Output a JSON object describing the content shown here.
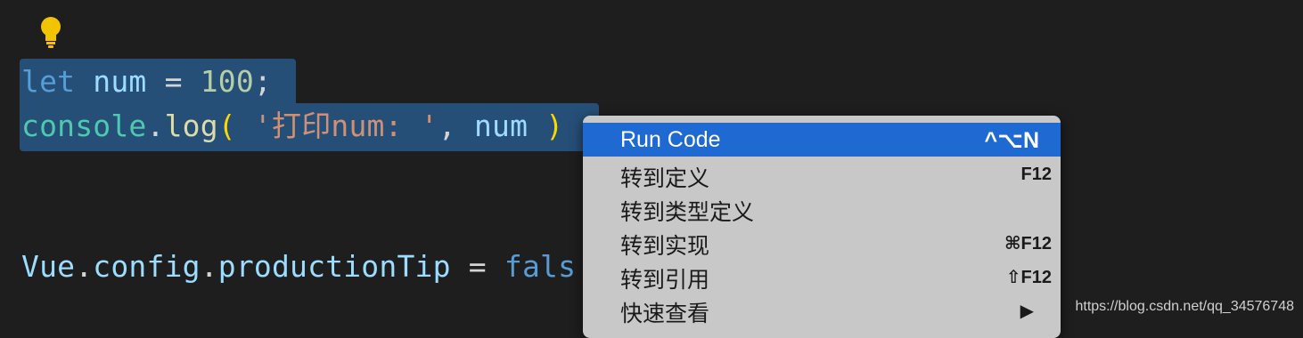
{
  "editor": {
    "line1": {
      "kw": "let",
      "var": "num",
      "op": "=",
      "num": "100",
      "semi": ";"
    },
    "line2": {
      "cls": "console",
      "dot": ".",
      "fn": "log",
      "lparen": "(",
      "str": "'打印num: '",
      "comma": ",",
      "var": "num",
      "rparen": ")"
    },
    "line3": {
      "obj": "Vue",
      "dot1": ".",
      "prop1": "config",
      "dot2": ".",
      "prop2": "productionTip",
      "op": "=",
      "val": "fals"
    }
  },
  "bulb": {
    "icon": "lightbulb-icon",
    "color": "#f2c400"
  },
  "context_menu": {
    "items": [
      {
        "label": "Run Code",
        "shortcut": "^⌥N",
        "active": true
      },
      {
        "label": "转到定义",
        "shortcut": "F12"
      },
      {
        "label": "转到类型定义",
        "shortcut": ""
      },
      {
        "label": "转到实现",
        "shortcut": "⌘F12"
      },
      {
        "label": "转到引用",
        "shortcut": "⇧F12"
      },
      {
        "label": "快速查看",
        "shortcut": "▶"
      }
    ]
  },
  "watermark": "https://blog.csdn.net/qq_34576748"
}
